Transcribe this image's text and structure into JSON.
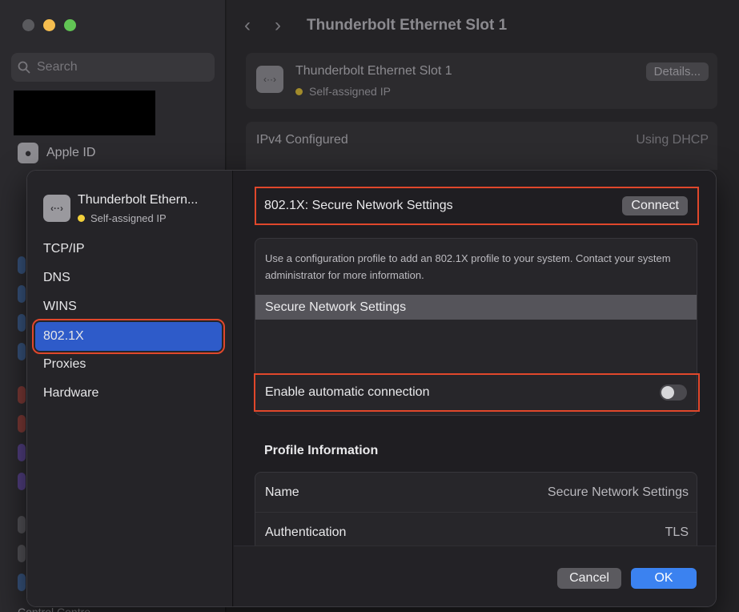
{
  "background": {
    "search_placeholder": "Search",
    "apple_id_label": "Apple ID",
    "nav_title": "Thunderbolt Ethernet Slot 1",
    "interface_card": {
      "name": "Thunderbolt Ethernet Slot 1",
      "status": "Self-assigned IP",
      "details_label": "Details..."
    },
    "ipv4": {
      "key": "IPv4 Configured",
      "value": "Using DHCP"
    },
    "bottom_peek": "Control Centre"
  },
  "sheet": {
    "header": {
      "name": "Thunderbolt Ethern...",
      "status": "Self-assigned IP",
      "icon": "ethernet-icon"
    },
    "sidebar": {
      "items": [
        {
          "label": "TCP/IP"
        },
        {
          "label": "DNS"
        },
        {
          "label": "WINS"
        },
        {
          "label": "802.1X",
          "active": true
        },
        {
          "label": "Proxies"
        },
        {
          "label": "Hardware"
        }
      ]
    },
    "dot1x": {
      "row_label": "802.1X:  Secure Network Settings",
      "connect_label": "Connect",
      "help_text": "Use a configuration profile to add an 802.1X profile to your system. Contact your system administrator for more information.",
      "selected_profile": "Secure Network Settings",
      "auto_connect_label": "Enable automatic connection",
      "auto_connect_enabled": false
    },
    "profile_info": {
      "title": "Profile Information",
      "rows": [
        {
          "key": "Name",
          "value": "Secure Network Settings"
        },
        {
          "key": "Authentication",
          "value": "TLS"
        }
      ]
    },
    "footer": {
      "cancel_label": "Cancel",
      "ok_label": "OK"
    }
  },
  "colors": {
    "accent": "#2e5bc9",
    "ok_button": "#3b82f0",
    "highlight_outline": "#e0472b",
    "status_dot": "#f2d03b"
  }
}
